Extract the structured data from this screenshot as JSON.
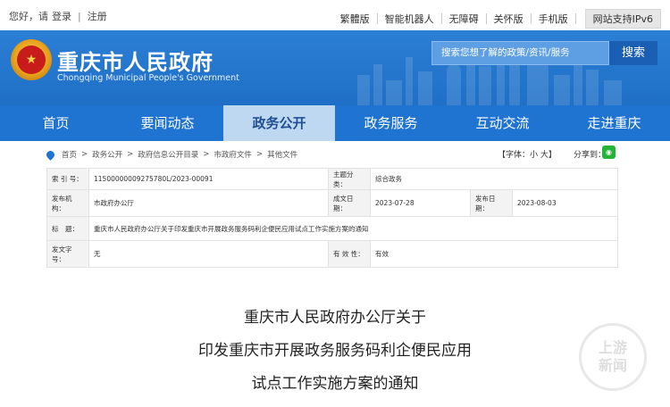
{
  "topbar": {
    "greeting": "您好，请",
    "login": "登录",
    "register": "注册",
    "links": [
      "繁體版",
      "智能机器人",
      "无障碍",
      "关怀版",
      "手机版"
    ],
    "ipv6": "网站支持IPv6"
  },
  "header": {
    "site_title": "重庆市人民政府",
    "site_subtitle": "Chongqing Municipal People's Government",
    "search_placeholder": "搜索您想了解的政策/资讯/服务",
    "search_button": "搜索",
    "accent_color": "#1f73d1"
  },
  "nav": {
    "items": [
      "首页",
      "要闻动态",
      "政务公开",
      "政务服务",
      "互动交流",
      "走进重庆"
    ],
    "active_index": 2
  },
  "breadcrumb": {
    "items": [
      "首页",
      "政务公开",
      "政府信息公开目录",
      "市政府文件",
      "其他文件"
    ],
    "separator": ">"
  },
  "font_size": {
    "label": "【字体：",
    "small": "小",
    "large": "大",
    "close": "】"
  },
  "share": {
    "label": "分享到："
  },
  "info_table": {
    "index_label": "索 引 号：",
    "index_value": "11500000009275780L/2023-00091",
    "category_label": "主题分类：",
    "category_value": "综合政务",
    "issuer_label": "发布机构：",
    "issuer_value": "市政府办公厅",
    "date_written_label": "成文日期：",
    "date_written_value": "2023-07-28",
    "date_published_label": "发布日期：",
    "date_published_value": "2023-08-03",
    "title_label": "标　题：",
    "title_value": "重庆市人民政府办公厅关于印发重庆市开展政务服务码利企便民应用试点工作实施方案的通知",
    "doc_no_label": "发文字号：",
    "doc_no_value": "无",
    "validity_label": "有 效 性：",
    "validity_value": "有效"
  },
  "document": {
    "title_lines": [
      "重庆市人民政府办公厅关于",
      "印发重庆市开展政务服务码利企便民应用",
      "试点工作实施方案的通知"
    ]
  },
  "watermark": {
    "line1": "上游",
    "line2": "新闻"
  }
}
